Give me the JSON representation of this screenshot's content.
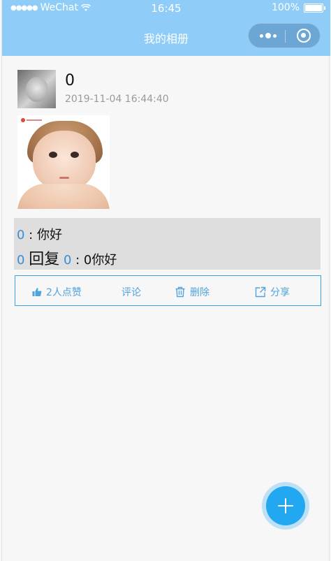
{
  "status_bar": {
    "signal": "●●●●●",
    "carrier": "WeChat",
    "time": "16:45",
    "battery": "100%"
  },
  "nav": {
    "title": "我的相册"
  },
  "post": {
    "username": "0",
    "timestamp": "2019-11-04 16:44:40",
    "comments": [
      {
        "user": "0",
        "separator": " : ",
        "text": "你好"
      }
    ],
    "replies": [
      {
        "from": "0",
        "reply_word": "回复",
        "to": "0",
        "separator": " : ",
        "text": "0你好"
      }
    ],
    "actions": {
      "like": "2人点赞",
      "comment": "评论",
      "delete": "删除",
      "share": "分享"
    }
  },
  "colors": {
    "nav_bg": "#8fcdf8",
    "accent": "#4fa3de",
    "fab": "#21a8f0",
    "comment_bg": "#dedede"
  }
}
